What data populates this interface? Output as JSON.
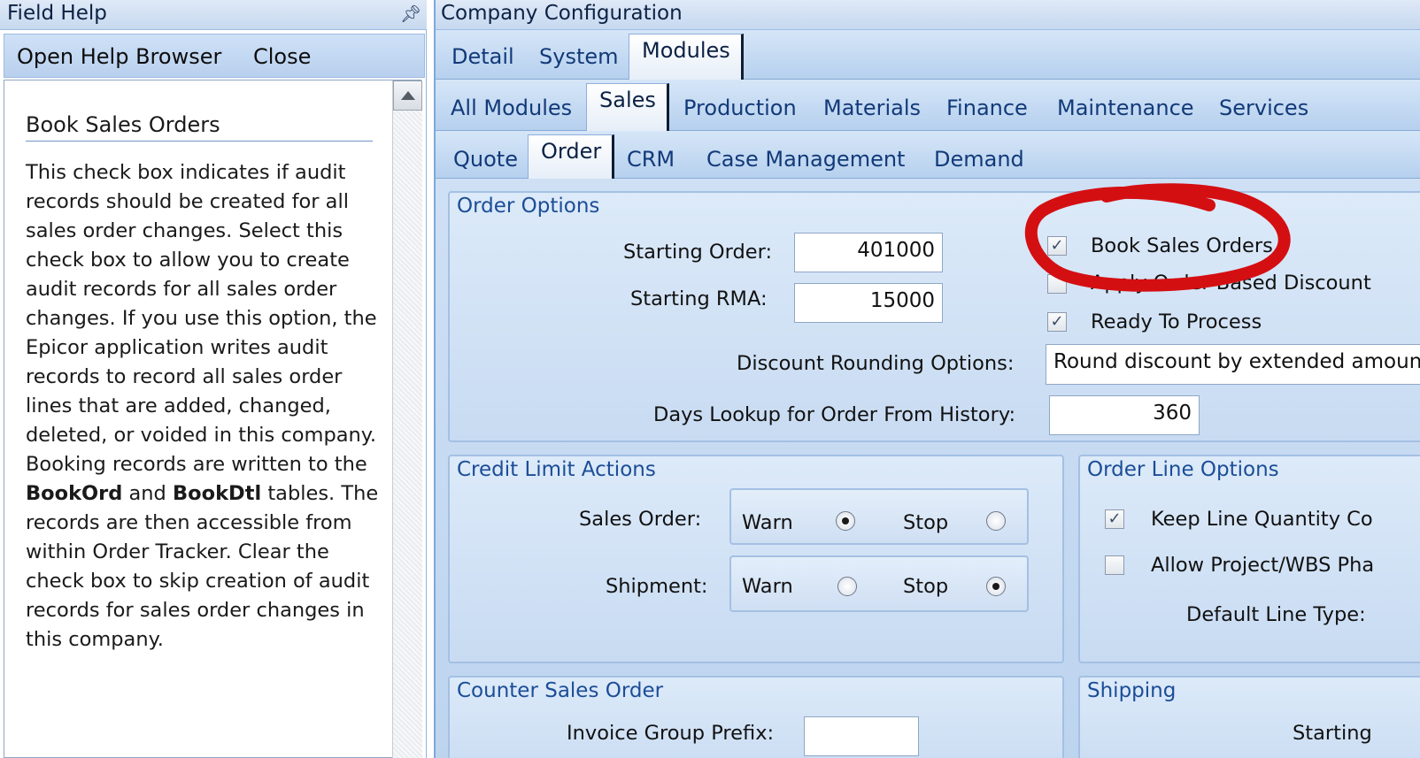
{
  "left_panel": {
    "title": "Field Help",
    "pin_icon": "pin-icon",
    "toolbar": {
      "open_help": "Open Help Browser",
      "close": "Close"
    },
    "heading": "Book Sales Orders",
    "body": {
      "p1": "This check box indicates if audit records should be created for all sales order changes. Select this check box to allow you to create audit records for all sales order changes. If you use this option, the Epicor application writes audit records to record all sales order lines that are added, changed, deleted, or voided in this company. Booking records are written to the ",
      "bold1": "BookOrd",
      "p2": " and ",
      "bold2": "BookDtl",
      "p3": " tables. The records are then accessible from within Order Tracker. Clear the check box to skip creation of audit records for sales order changes in this company."
    }
  },
  "right_panel": {
    "title": "Company Configuration",
    "tabs1": [
      "Detail",
      "System",
      "Modules"
    ],
    "tabs2": [
      "All Modules",
      "Sales",
      "Production",
      "Materials",
      "Finance",
      "Maintenance",
      "Services"
    ],
    "tabs3": [
      "Quote",
      "Order",
      "CRM",
      "Case Management",
      "Demand"
    ],
    "order_options": {
      "title": "Order Options",
      "starting_order_label": "Starting Order:",
      "starting_order_value": "401000",
      "starting_rma_label": "Starting RMA:",
      "starting_rma_value": "15000",
      "book_sales_orders": "Book Sales Orders",
      "book_sales_orders_checked": true,
      "apply_discount": "Apply Order Based Discount",
      "apply_discount_checked": false,
      "ready_to_process": "Ready To Process",
      "ready_to_process_checked": true,
      "discount_rounding_label": "Discount Rounding Options:",
      "discount_rounding_value": "Round discount by extended amount",
      "days_lookup_label": "Days Lookup for Order From History:",
      "days_lookup_value": "360"
    },
    "credit_limit": {
      "title": "Credit Limit Actions",
      "sales_order_label": "Sales Order:",
      "shipment_label": "Shipment:",
      "warn": "Warn",
      "stop": "Stop",
      "sales_order_selected": "Warn",
      "shipment_selected": "Stop"
    },
    "order_line": {
      "title": "Order Line Options",
      "keep_line": "Keep Line Quantity Co",
      "keep_line_checked": true,
      "allow_project": "Allow Project/WBS Pha",
      "allow_project_checked": false,
      "default_line_type_label": "Default Line Type:"
    },
    "counter_sales": {
      "title": "Counter Sales Order",
      "invoice_group_prefix": "Invoice Group Prefix:"
    },
    "shipping": {
      "title": "Shipping",
      "starting_label": "Starting"
    }
  },
  "annotation": {
    "color": "#d40f12"
  }
}
